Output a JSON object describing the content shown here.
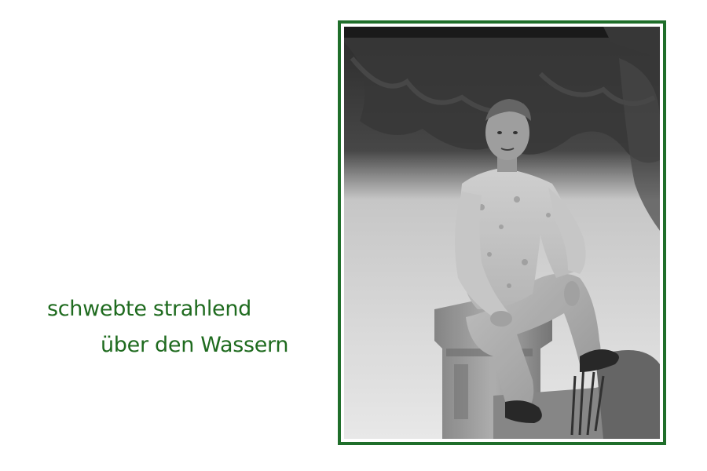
{
  "caption": {
    "line1": "schwebte strahlend",
    "line2": "über den Wassern"
  },
  "photo": {
    "style": "black-and-white",
    "frame_color": "#1f6e2a"
  },
  "colors": {
    "text": "#1f6b1f",
    "frame": "#1f6e2a",
    "background": "#ffffff"
  }
}
